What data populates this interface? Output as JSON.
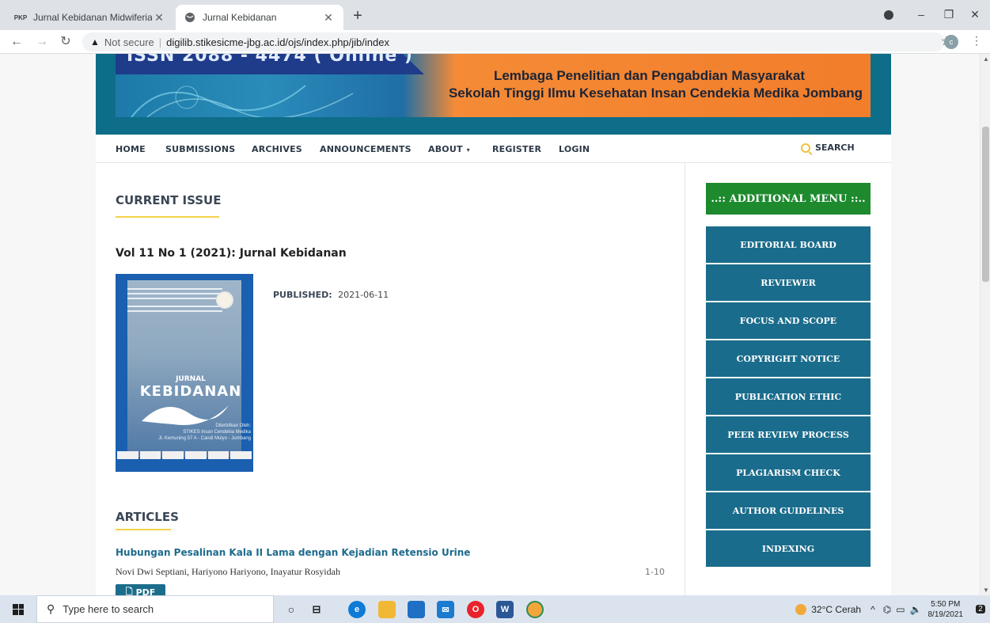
{
  "browser": {
    "tabs": [
      {
        "favicon": "PKP",
        "title": "Jurnal Kebidanan Midwiferia",
        "active": false
      },
      {
        "favicon": "globe-icon",
        "title": "Jurnal Kebidanan",
        "active": true
      }
    ],
    "new_tab": "+",
    "omnibox": {
      "security_text": "Not secure",
      "separator": "|",
      "url": "digilib.stikesicme-jbg.ac.id/ojs/index.php/jib/index"
    },
    "profile_initial": "c"
  },
  "banner": {
    "issn_partial": "ISSN 2088 - 4474 ( Online )",
    "line1": "Lembaga Penelitian dan Pengabdian Masyarakat",
    "line2": "Sekolah Tinggi Ilmu Kesehatan Insan Cendekia Medika Jombang"
  },
  "nav": {
    "items": [
      "HOME",
      "SUBMISSIONS",
      "ARCHIVES",
      "ANNOUNCEMENTS",
      "ABOUT",
      "REGISTER",
      "LOGIN"
    ],
    "search": "SEARCH"
  },
  "main": {
    "current_issue_heading": "CURRENT ISSUE",
    "issue_title": "Vol 11 No 1 (2021): Jurnal Kebidanan",
    "published_label": "PUBLISHED:",
    "published_date": "2021-06-11",
    "cover": {
      "prefix": "JURNAL",
      "name": "KEBIDANAN",
      "publisher_lines": [
        "Diterbitkan Oleh:",
        "STIKES Insan Cendekia Medika",
        "Jl. Kemuning 57 A - Candi Mulyo - Jombang"
      ]
    },
    "articles_heading": "ARTICLES",
    "articles": [
      {
        "title": "Hubungan Pesalinan Kala II Lama dengan Kejadian Retensio Urine",
        "authors": "Novi Dwi Septiani, Hariyono Hariyono, Inayatur Rosyidah",
        "pages": "1-10",
        "pdf_label": "PDF"
      }
    ]
  },
  "sidebar": {
    "title": "..:: ADDITIONAL MENU ::..",
    "items": [
      "EDITORIAL BOARD",
      "REVIEWER",
      "FOCUS AND SCOPE",
      "COPYRIGHT NOTICE",
      "PUBLICATION ETHIC",
      "PEER REVIEW PROCESS",
      "PLAGIARISM CHECK",
      "AUTHOR GUIDELINES",
      "INDEXING"
    ]
  },
  "taskbar": {
    "search_placeholder": "Type here to search",
    "weather": "32°C  Cerah",
    "time": "5:50 PM",
    "date": "8/19/2021",
    "notification_count": "2"
  },
  "colors": {
    "header_teal": "#0e6d89",
    "sidebar_blue": "#1a6c8c",
    "sidebar_green": "#1c8a2d",
    "accent_yellow": "#f3d34a",
    "banner_orange": "#f27d2b"
  }
}
